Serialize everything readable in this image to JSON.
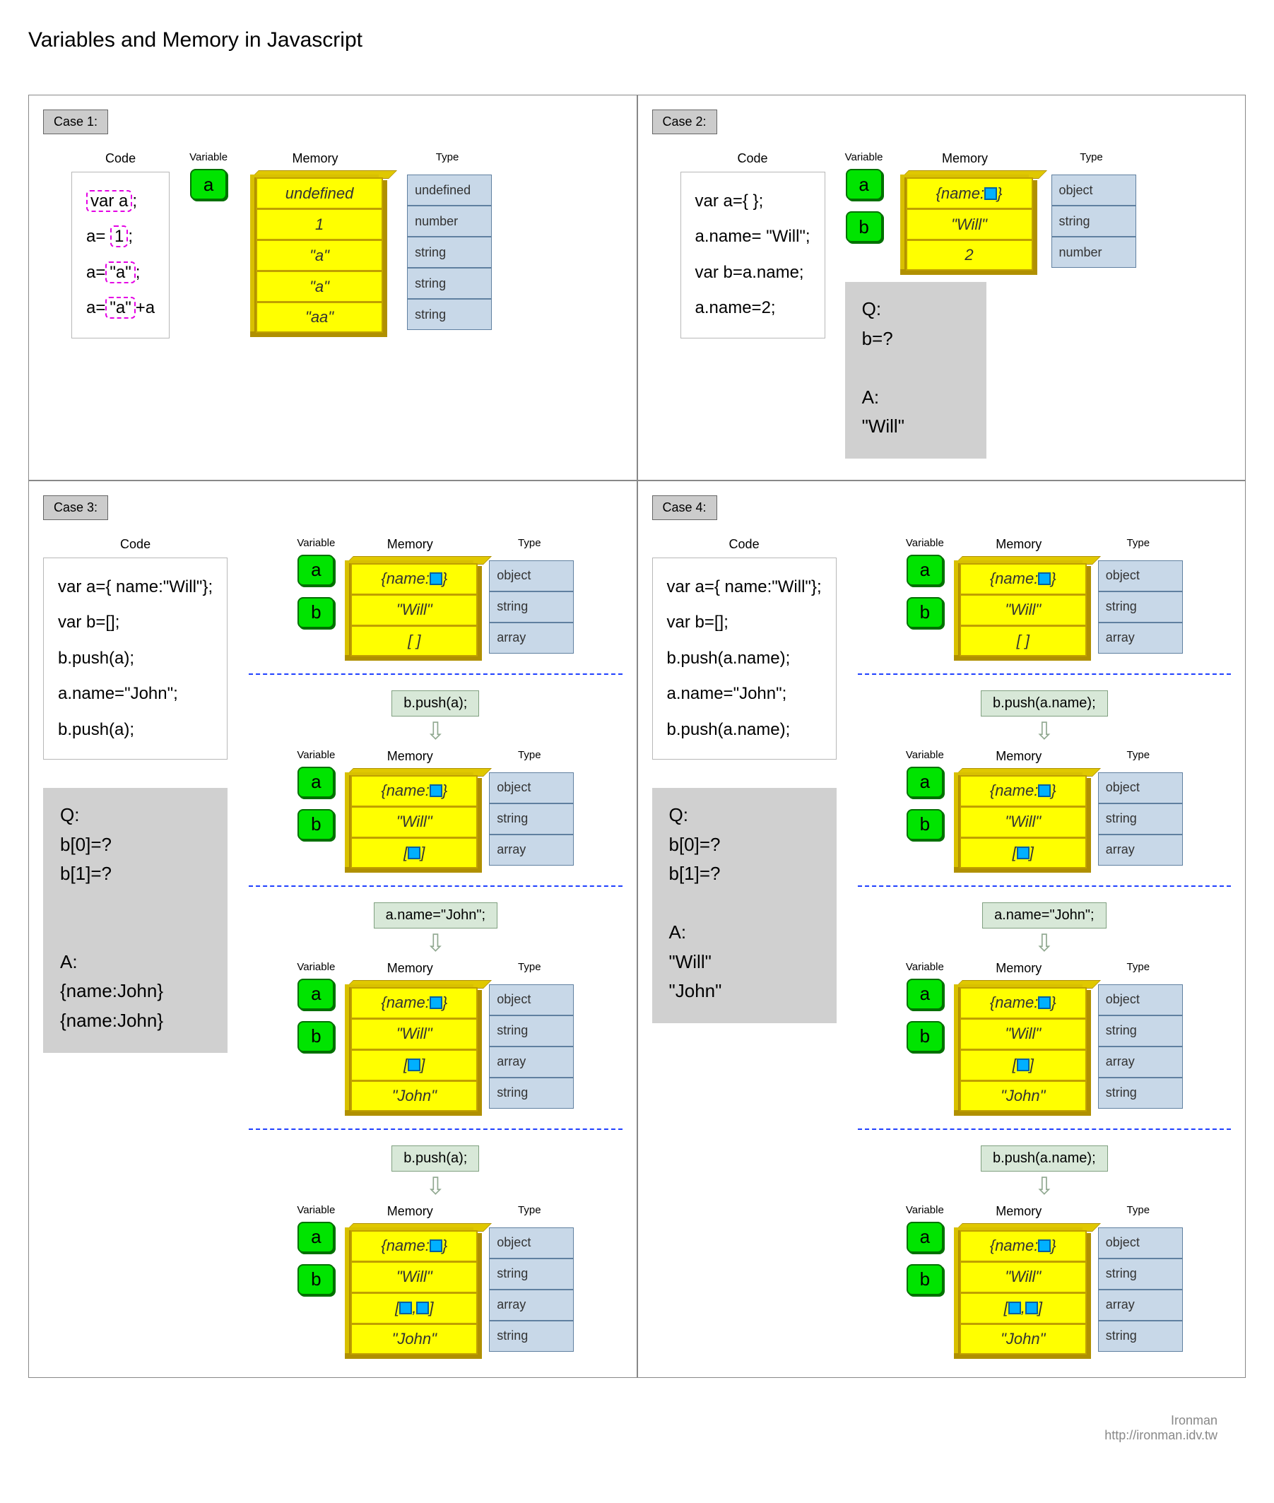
{
  "title": "Variables and Memory in Javascript",
  "footer": {
    "author": "Ironman",
    "url": "http://ironman.idv.tw"
  },
  "labels": {
    "code": "Code",
    "variable": "Variable",
    "memory": "Memory",
    "type": "Type"
  },
  "cases": {
    "c1": {
      "label": "Case 1:",
      "code": [
        "var a;",
        "a= 1;",
        "a=\"a\";",
        "a=\"a\"+a"
      ],
      "code_highlights": [
        "var a",
        "1",
        "\"a\"",
        "\"a\""
      ],
      "vars": [
        "a"
      ],
      "memory": [
        "undefined",
        "1",
        "\"a\"",
        "\"a\"",
        "\"aa\""
      ],
      "types": [
        "undefined",
        "number",
        "string",
        "string",
        "string"
      ]
    },
    "c2": {
      "label": "Case 2:",
      "code": [
        "var a={ };",
        "a.name= \"Will\";",
        "var b=a.name;",
        "a.name=2;"
      ],
      "vars": [
        "a",
        "b"
      ],
      "memory": [
        "{name: · }",
        "\"Will\"",
        "2"
      ],
      "types": [
        "object",
        "string",
        "number"
      ],
      "qa": {
        "q_label": "Q:",
        "q": "b=?",
        "a_label": "A:",
        "a": "\"Will\""
      }
    },
    "c3": {
      "label": "Case 3:",
      "code": [
        "var a={ name:\"Will\"};",
        "var b=[];",
        "b.push(a);",
        "a.name=\"John\";",
        "b.push(a);"
      ],
      "vars": [
        "a",
        "b"
      ],
      "qa": {
        "q_label": "Q:",
        "q1": "b[0]=?",
        "q2": "b[1]=?",
        "a_label": "A:",
        "a1": "{name:John}",
        "a2": "{name:John}"
      },
      "steps": [
        {
          "label": null,
          "memory": [
            "{name: · }",
            "\"Will\"",
            "[ ]"
          ],
          "types": [
            "object",
            "string",
            "array"
          ]
        },
        {
          "label": "b.push(a);",
          "memory": [
            "{name: · }",
            "\"Will\"",
            "[ · ]"
          ],
          "types": [
            "object",
            "string",
            "array"
          ]
        },
        {
          "label": "a.name=\"John\";",
          "memory": [
            "{name: · }",
            "\"Will\"",
            "[ · ]",
            "\"John\""
          ],
          "types": [
            "object",
            "string",
            "array",
            "string"
          ]
        },
        {
          "label": "b.push(a);",
          "memory": [
            "{name: · }",
            "\"Will\"",
            "[ · , · ]",
            "\"John\""
          ],
          "types": [
            "object",
            "string",
            "array",
            "string"
          ]
        }
      ]
    },
    "c4": {
      "label": "Case 4:",
      "code": [
        "var a={ name:\"Will\"};",
        "var b=[];",
        "b.push(a.name);",
        "a.name=\"John\";",
        "b.push(a.name);"
      ],
      "vars": [
        "a",
        "b"
      ],
      "qa": {
        "q_label": "Q:",
        "q1": "b[0]=?",
        "q2": "b[1]=?",
        "a_label": "A:",
        "a1": "\"Will\"",
        "a2": "\"John\""
      },
      "steps": [
        {
          "label": null,
          "memory": [
            "{name: · }",
            "\"Will\"",
            "[ ]"
          ],
          "types": [
            "object",
            "string",
            "array"
          ]
        },
        {
          "label": "b.push(a.name);",
          "memory": [
            "{name: · }",
            "\"Will\"",
            "[ · ]"
          ],
          "types": [
            "object",
            "string",
            "array"
          ]
        },
        {
          "label": "a.name=\"John\";",
          "memory": [
            "{name: · }",
            "\"Will\"",
            "[ · ]",
            "\"John\""
          ],
          "types": [
            "object",
            "string",
            "array",
            "string"
          ]
        },
        {
          "label": "b.push(a.name);",
          "memory": [
            "{name: · }",
            "\"Will\"",
            "[ · , · ]",
            "\"John\""
          ],
          "types": [
            "object",
            "string",
            "array",
            "string"
          ]
        }
      ]
    }
  }
}
